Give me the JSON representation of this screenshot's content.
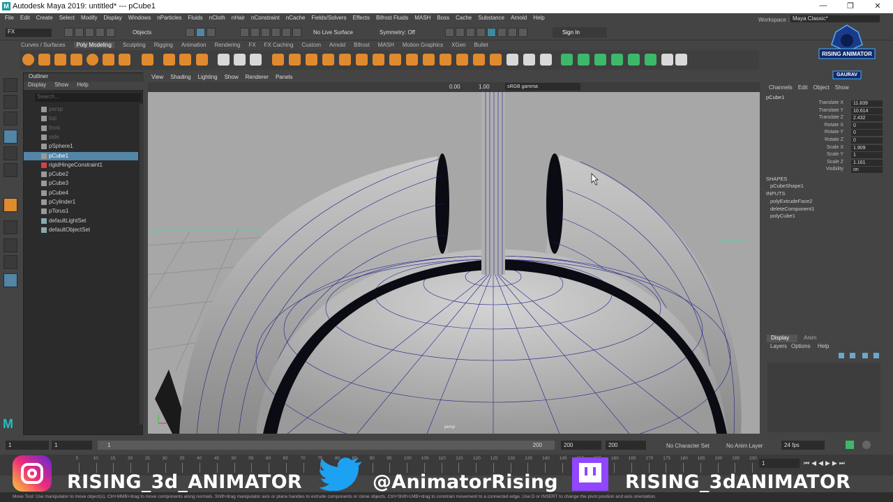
{
  "window": {
    "title": "Autodesk Maya 2019: untitled*   ---   pCube1",
    "logo": "M",
    "min": "—",
    "max": "❐",
    "close": "✕"
  },
  "menu": [
    "File",
    "Edit",
    "Create",
    "Select",
    "Modify",
    "Display",
    "Windows",
    "nParticles",
    "Fluids",
    "nCloth",
    "nHair",
    "nConstraint",
    "nCache",
    "Fields/Solvers",
    "Effects",
    "Bifrost Fluids",
    "MASH",
    "Boss",
    "Cache",
    "Substance",
    "Arnold",
    "Help"
  ],
  "workspace": {
    "label": "Workspace :",
    "value": "Maya Classic*"
  },
  "status": {
    "mode": "FX",
    "objects": "Objects",
    "live": "No Live Surface",
    "symmetry": "Symmetry: Off",
    "signin": "Sign In"
  },
  "shelf_tabs": [
    "Curves / Surfaces",
    "Poly Modeling",
    "Sculpting",
    "Rigging",
    "Animation",
    "Rendering",
    "FX",
    "FX Caching",
    "Custom",
    "Arnold",
    "Bifrost",
    "MASH",
    "Motion Graphics",
    "XGen",
    "Bullet"
  ],
  "shelf_active": "Poly Modeling",
  "outliner": {
    "title": "Outliner",
    "menu": [
      "Display",
      "Show",
      "Help"
    ],
    "search": "Search...",
    "items": [
      {
        "name": "persp",
        "dim": true
      },
      {
        "name": "top",
        "dim": true
      },
      {
        "name": "front",
        "dim": true
      },
      {
        "name": "side",
        "dim": true
      },
      {
        "name": "pSphere1"
      },
      {
        "name": "pCube1",
        "selected": true
      },
      {
        "name": "rigidHingeConstraint1"
      },
      {
        "name": "pCube2"
      },
      {
        "name": "pCube3"
      },
      {
        "name": "pCube4"
      },
      {
        "name": "pCylinder1"
      },
      {
        "name": "pTorus1"
      },
      {
        "name": "defaultLightSet"
      },
      {
        "name": "defaultObjectSet"
      }
    ]
  },
  "viewport": {
    "menu": [
      "View",
      "Shading",
      "Lighting",
      "Show",
      "Renderer",
      "Panels"
    ],
    "near": "0.00",
    "far": "1.00",
    "color": "sRGB gamma",
    "camera": "persp"
  },
  "channelbox": {
    "menu": [
      "Channels",
      "Edit",
      "Object",
      "Show"
    ],
    "object": "pCube1",
    "attrs": [
      {
        "n": "Translate X",
        "v": "11.839"
      },
      {
        "n": "Translate Y",
        "v": "10.614"
      },
      {
        "n": "Translate Z",
        "v": "2.432"
      },
      {
        "n": "Rotate X",
        "v": "0"
      },
      {
        "n": "Rotate Y",
        "v": "0"
      },
      {
        "n": "Rotate Z",
        "v": "0"
      },
      {
        "n": "Scale X",
        "v": "1.909"
      },
      {
        "n": "Scale Y",
        "v": "1"
      },
      {
        "n": "Scale Z",
        "v": "1.161"
      },
      {
        "n": "Visibility",
        "v": "on"
      }
    ],
    "shapes_h": "SHAPES",
    "shape": "pCubeShape1",
    "inputs_h": "INPUTS",
    "inputs": [
      "polyExtrudeFace2",
      "deleteComponent1",
      "polyCube1"
    ]
  },
  "layers": {
    "tabs": [
      "Display",
      "Anim"
    ],
    "menu": [
      "Layers",
      "Options",
      "Help"
    ]
  },
  "timeslider": {
    "start": "1",
    "cur": "1",
    "box": "1",
    "end1": "200",
    "end2": "200",
    "end3": "200",
    "charset": "No Character Set",
    "animlayer": "No Anim Layer",
    "fps": "24 fps",
    "frame": "1"
  },
  "ticks": [
    "5",
    "10",
    "15",
    "20",
    "25",
    "30",
    "35",
    "40",
    "45",
    "50",
    "55",
    "60",
    "65",
    "70",
    "75",
    "80",
    "85",
    "90",
    "95",
    "100",
    "105",
    "110",
    "115",
    "120",
    "125",
    "130",
    "135",
    "140",
    "145",
    "150",
    "155",
    "160",
    "165",
    "170",
    "175",
    "180",
    "185",
    "190",
    "195",
    "200"
  ],
  "help": "Move Tool: Use manipulator to move object(s). Ctrl+MMB+drag to move components along normals. Shift+drag manipulator axis or plane handles to extrude components or clone objects. Ctrl+Shift+LMB+drag to constrain movement to a connected edge. Use D or INSERT to change the pivot position and axis orientation.",
  "watermark": {
    "title": "RISING ANIMATOR",
    "name": "GAURAV"
  },
  "social": {
    "instagram": "RISING_3d_ANIMATOR",
    "twitter": "@AnimatorRising",
    "twitch": "RISING_3dANIMATOR"
  },
  "colors": {
    "select": "#5285a6",
    "viewport": "#a7a7a7",
    "wire": "#1e1e8c"
  }
}
